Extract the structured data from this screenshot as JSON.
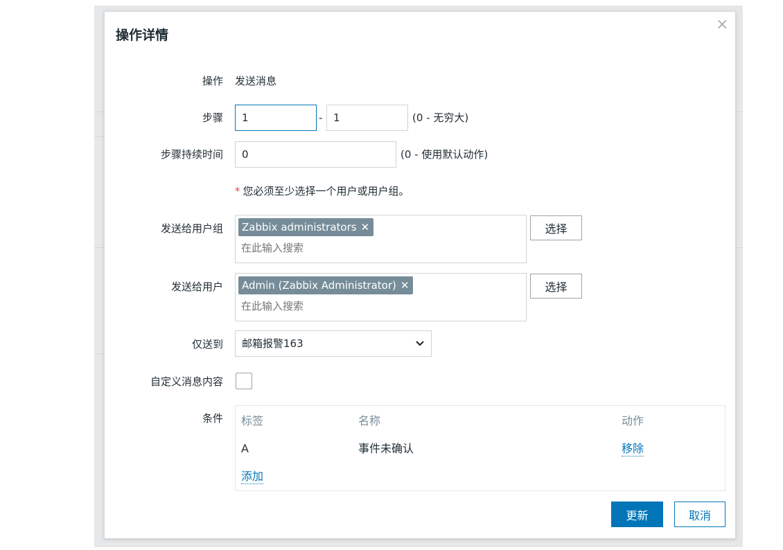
{
  "dialog": {
    "title": "操作详情",
    "close_icon": "close-icon"
  },
  "operation": {
    "label": "操作",
    "value": "发送消息"
  },
  "steps": {
    "label": "步骤",
    "from": "1",
    "separator": "-",
    "to": "1",
    "hint": "(0 - 无穷大)"
  },
  "step_duration": {
    "label": "步骤持续时间",
    "value": "0",
    "hint": "(0 - 使用默认动作)"
  },
  "requirement": {
    "asterisk": "*",
    "text": "您必须至少选择一个用户或用户组。"
  },
  "user_groups": {
    "label": "发送给用户组",
    "tags": [
      {
        "text": "Zabbix administrators",
        "remove": "✕"
      }
    ],
    "placeholder": "在此输入搜索",
    "select_label": "选择"
  },
  "users": {
    "label": "发送给用户",
    "tags": [
      {
        "text": "Admin (Zabbix Administrator)",
        "remove": "✕"
      }
    ],
    "placeholder": "在此输入搜索",
    "select_label": "选择"
  },
  "send_only_to": {
    "label": "仅送到",
    "value": "邮箱报警163"
  },
  "custom_message": {
    "label": "自定义消息内容",
    "checked": false
  },
  "conditions": {
    "label": "条件",
    "headers": [
      "标签",
      "名称",
      "动作"
    ],
    "rows": [
      {
        "tag": "A",
        "name": "事件未确认",
        "action": "移除"
      }
    ],
    "add_label": "添加"
  },
  "footer": {
    "update_label": "更新",
    "cancel_label": "取消"
  },
  "colors": {
    "primary": "#0275b8",
    "tag_bg": "#768d99",
    "required": "#d64e4e"
  }
}
